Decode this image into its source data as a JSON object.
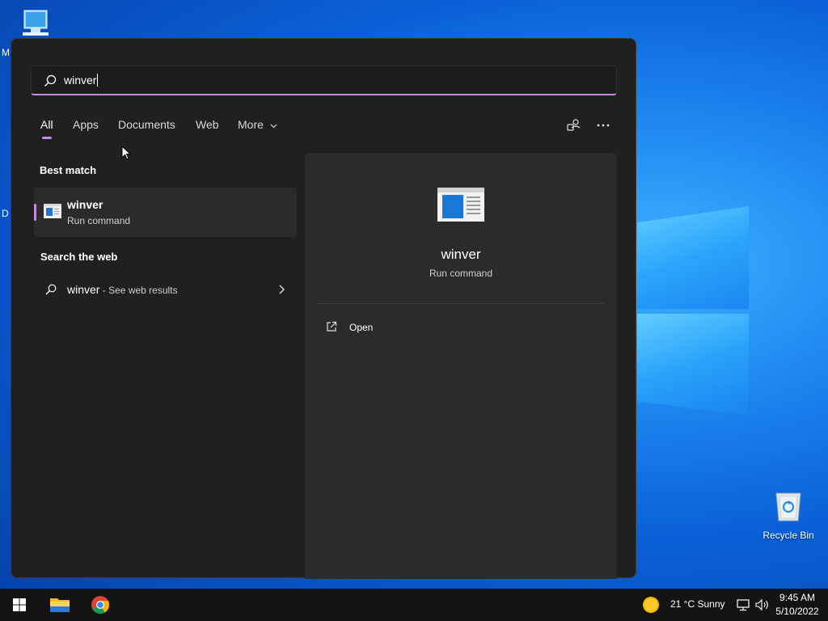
{
  "desktop": {
    "left_icon_label_top": "M",
    "left_icon_label_mid": "D",
    "recycle_bin_label": "Recycle Bin"
  },
  "search": {
    "query": "winver",
    "icon": "search-icon"
  },
  "tabs": [
    {
      "label": "All",
      "active": true
    },
    {
      "label": "Apps"
    },
    {
      "label": "Documents"
    },
    {
      "label": "Web"
    },
    {
      "label": "More"
    }
  ],
  "sections": {
    "best_match": "Best match",
    "search_web": "Search the web"
  },
  "best_match_item": {
    "title": "winver",
    "subtitle": "Run command"
  },
  "web_result": {
    "query": "winver",
    "suffix": " - See web results"
  },
  "detail": {
    "title": "winver",
    "subtitle": "Run command",
    "actions": [
      {
        "label": "Open",
        "icon": "open-external-icon"
      }
    ]
  },
  "tray": {
    "weather": "21 °C  Sunny",
    "time": "9:45 AM",
    "date": "5/10/2022"
  },
  "colors": {
    "accent": "#c48adf",
    "panel_bg": "#202020",
    "card_bg": "#2b2b2b",
    "taskbar_bg": "#141414"
  }
}
